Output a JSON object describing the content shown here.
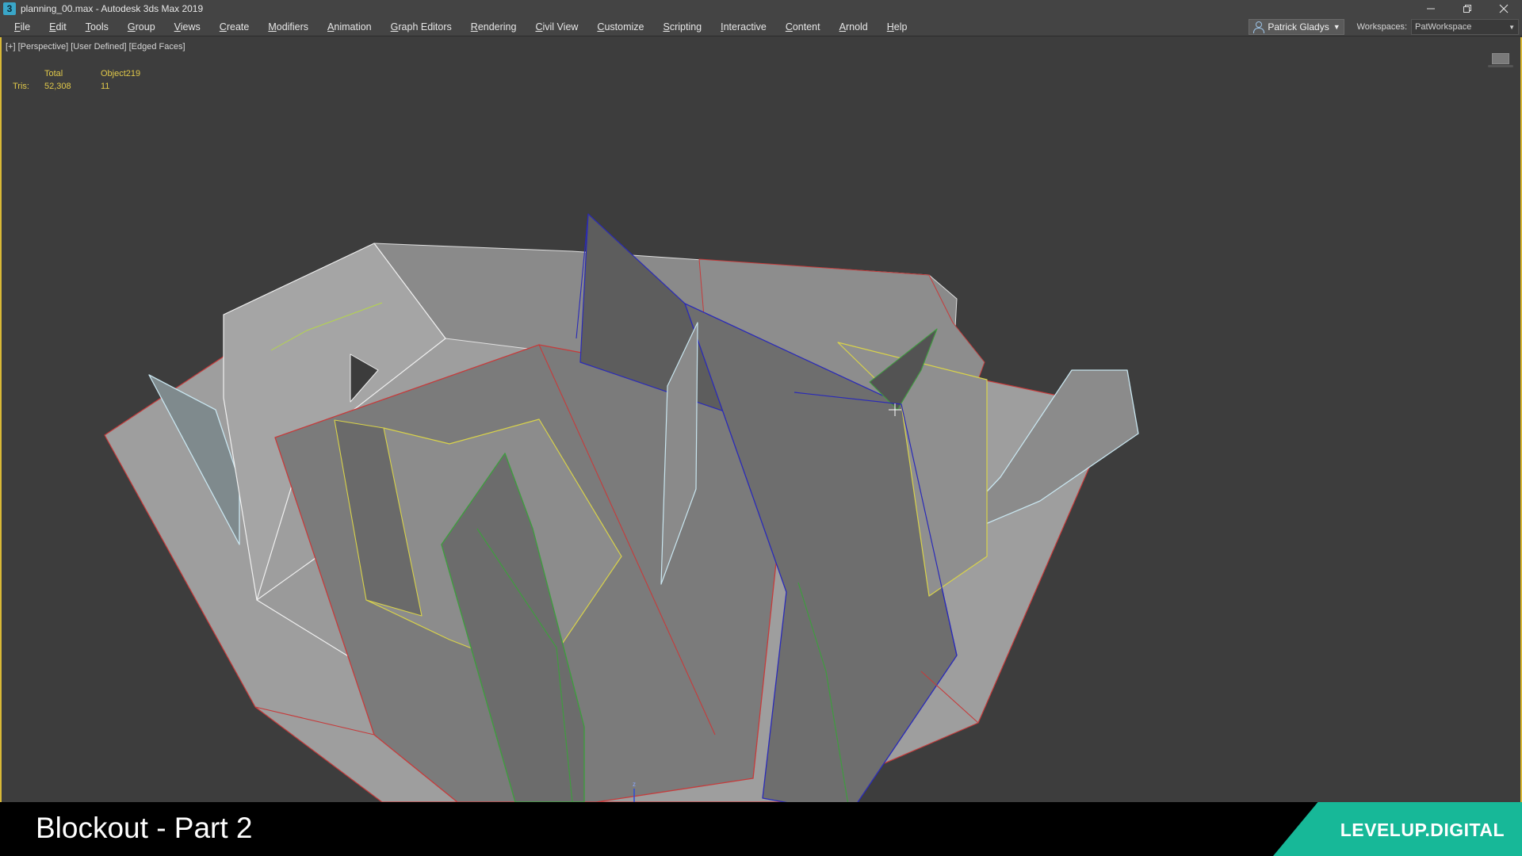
{
  "window": {
    "app_icon": "3",
    "title": "planning_00.max - Autodesk 3ds Max 2019",
    "controls": [
      "minimize-icon",
      "restore-icon",
      "close-icon"
    ]
  },
  "menu": {
    "items": [
      "File",
      "Edit",
      "Tools",
      "Group",
      "Views",
      "Create",
      "Modifiers",
      "Animation",
      "Graph Editors",
      "Rendering",
      "Civil View",
      "Customize",
      "Scripting",
      "Interactive",
      "Content",
      "Arnold",
      "Help"
    ],
    "user": "Patrick Gladys",
    "workspaces_label": "Workspaces:",
    "workspace": "PatWorkspace"
  },
  "viewport": {
    "label": "[+] [Perspective] [User Defined] [Edged Faces]",
    "stats": {
      "header_total": "Total",
      "header_object": "Object219",
      "row_label": "Tris:",
      "total_tris": "52,308",
      "object_tris": "11"
    },
    "axis_label": "z",
    "colors": {
      "background": "#3d3d3d",
      "border": "#d9b937",
      "stats_text": "#e0c84a"
    }
  },
  "banner": {
    "title": "Blockout - Part 2",
    "brand": "LEVELUP.DIGITAL",
    "brand_color": "#17b898"
  }
}
